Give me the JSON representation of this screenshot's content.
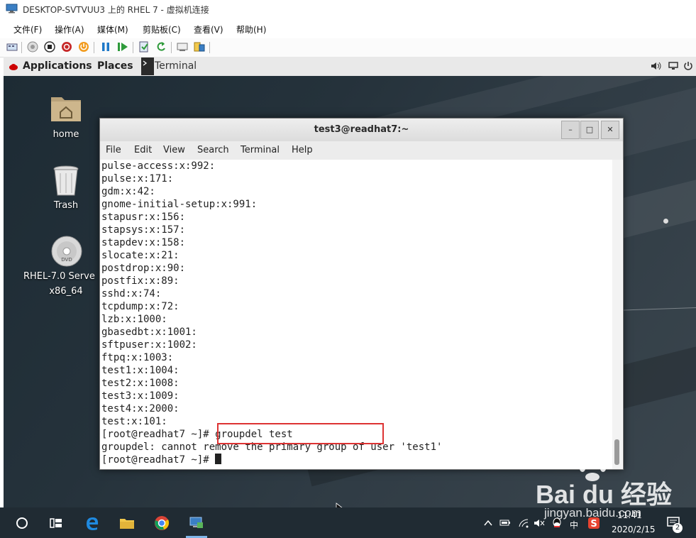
{
  "window": {
    "title": "DESKTOP-SVTVUU3 上的 RHEL 7 - 虚拟机连接",
    "menu": [
      "文件(F)",
      "操作(A)",
      "媒体(M)",
      "剪贴板(C)",
      "查看(V)",
      "帮助(H)"
    ]
  },
  "gnome": {
    "applications": "Applications",
    "places": "Places",
    "terminal": "Terminal"
  },
  "desktop_icons": {
    "home": "home",
    "trash": "Trash",
    "dvd_line1": "RHEL-7.0 Serve",
    "dvd_line2": "x86_64"
  },
  "terminal": {
    "title": "test3@readhat7:~",
    "menu": [
      "File",
      "Edit",
      "View",
      "Search",
      "Terminal",
      "Help"
    ],
    "lines": [
      "pulse-access:x:992:",
      "pulse:x:171:",
      "gdm:x:42:",
      "gnome-initial-setup:x:991:",
      "stapusr:x:156:",
      "stapsys:x:157:",
      "stapdev:x:158:",
      "slocate:x:21:",
      "postdrop:x:90:",
      "postfix:x:89:",
      "sshd:x:74:",
      "tcpdump:x:72:",
      "lzb:x:1000:",
      "gbasedbt:x:1001:",
      "sftpuser:x:1002:",
      "ftpq:x:1003:",
      "test1:x:1004:",
      "test2:x:1008:",
      "test3:x:1009:",
      "test4:x:2000:",
      "test:x:101:",
      "[root@readhat7 ~]# groupdel test",
      "groupdel: cannot remove the primary group of user 'test1'"
    ],
    "prompt": "[root@readhat7 ~]# "
  },
  "taskbar": {
    "time": "11:41",
    "date": "2020/2/15",
    "ime": "中",
    "notifications": "2"
  },
  "watermark": {
    "brand": "Bai du 经验",
    "url": "jingyan.baidu.com"
  },
  "colors": {
    "highlight_box": "#dd3333",
    "taskbar": "#202b33",
    "desktop": "#25323b"
  }
}
